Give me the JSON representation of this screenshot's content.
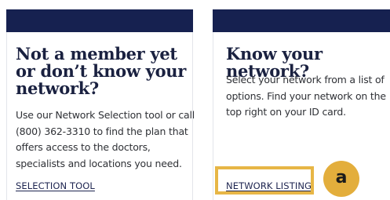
{
  "cards": [
    {
      "title": "Not a member yet or don’t know your network?",
      "body": "Use our Network Selection tool or call (800) 362-3310 to find the plan that offers access to the doctors, specialists and locations you need.",
      "link_label": "SELECTION TOOL"
    },
    {
      "title": "Know your network?",
      "body": "Select your network from a list of options. Find your network on the top right on your ID card.",
      "link_label": "NETWORK LISTING"
    }
  ],
  "annotation": {
    "label": "a",
    "highlight_color": "#e7b646"
  },
  "colors": {
    "header_band": "#162150",
    "title_text": "#1a2140",
    "body_text": "#2f3136",
    "link_text": "#1e2550"
  }
}
